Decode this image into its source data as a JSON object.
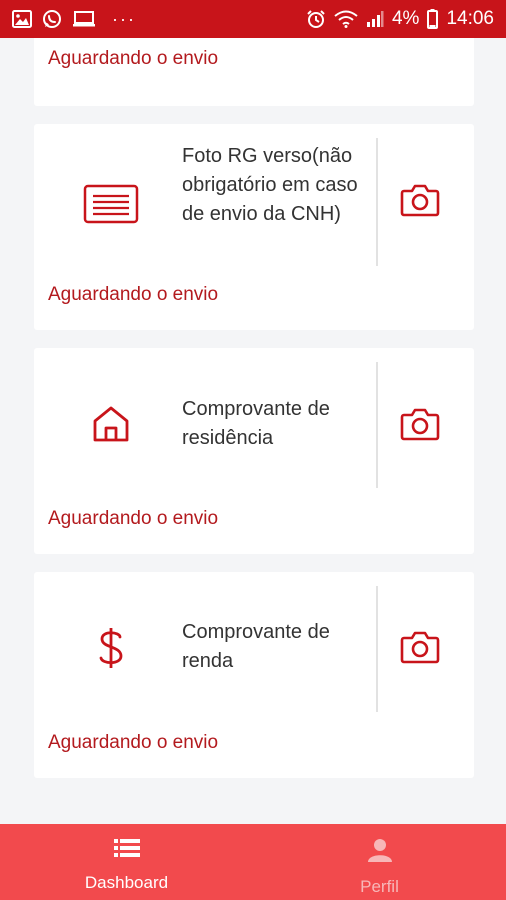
{
  "statusbar": {
    "left_icons": [
      "image-icon",
      "whatsapp-icon",
      "laptop-icon",
      "more-dots-icon"
    ],
    "more": "···",
    "right_icons": [
      "alarm-icon",
      "wifi-icon",
      "signal-icon",
      "battery-icon"
    ],
    "battery": "4%",
    "time": "14:06"
  },
  "cards": [
    {
      "status": "Aguardando o envio"
    },
    {
      "icon": "id-card-icon",
      "title": "Foto RG verso(não obrigatório em caso de envio da CNH)",
      "status": "Aguardando o envio",
      "action_icon": "camera-icon"
    },
    {
      "icon": "home-icon",
      "title": "Comprovante de residência",
      "status": "Aguardando o envio",
      "action_icon": "camera-icon"
    },
    {
      "icon": "dollar-icon",
      "title": "Comprovante de renda",
      "status": "Aguardando o envio",
      "action_icon": "camera-icon"
    }
  ],
  "nav": {
    "items": [
      {
        "label": "Dashboard",
        "icon": "list-icon",
        "active": true
      },
      {
        "label": "Perfil",
        "icon": "user-icon",
        "active": false
      }
    ]
  },
  "colors": {
    "accent": "#c8141a",
    "nav_bg": "#f24a4d",
    "status_text": "#b31a1e"
  }
}
